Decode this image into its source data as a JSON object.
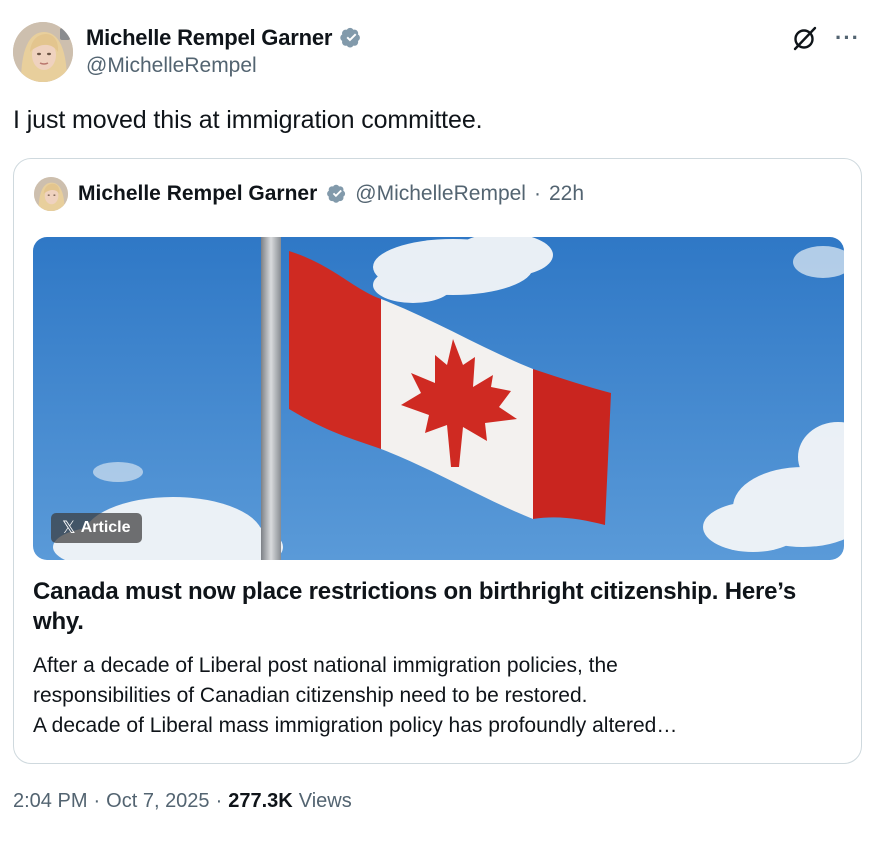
{
  "author": {
    "name": "Michelle Rempel Garner",
    "handle": "@MichelleRempel"
  },
  "icons": {
    "verified": "verified-badge-icon",
    "grok": "grok-icon",
    "more": "more-icon"
  },
  "more_label": "···",
  "tweet": {
    "text": "I just moved this at immigration committee."
  },
  "quote": {
    "name": "Michelle Rempel Garner",
    "handle": "@MichelleRempel",
    "separator": "·",
    "time": "22h",
    "badge_x": "𝕏",
    "badge_label": "Article",
    "article_title": "Canada must now place restrictions on birthright citizenship. Here’s why.",
    "article_body": [
      "After a decade of Liberal post national immigration policies, the",
      "responsibilities of Canadian citizenship need to be restored.",
      "A decade of Liberal mass immigration policy has profoundly altered…"
    ]
  },
  "meta": {
    "time": "2:04 PM",
    "sep1": "·",
    "date": "Oct 7, 2025",
    "sep2": "·",
    "views_count": "277.3K",
    "views_label": "Views"
  },
  "colors": {
    "text": "#0f1419",
    "secondary": "#536471",
    "verified": "#829aab",
    "border": "#cfd9de",
    "flag_red": "#d52b1e"
  }
}
